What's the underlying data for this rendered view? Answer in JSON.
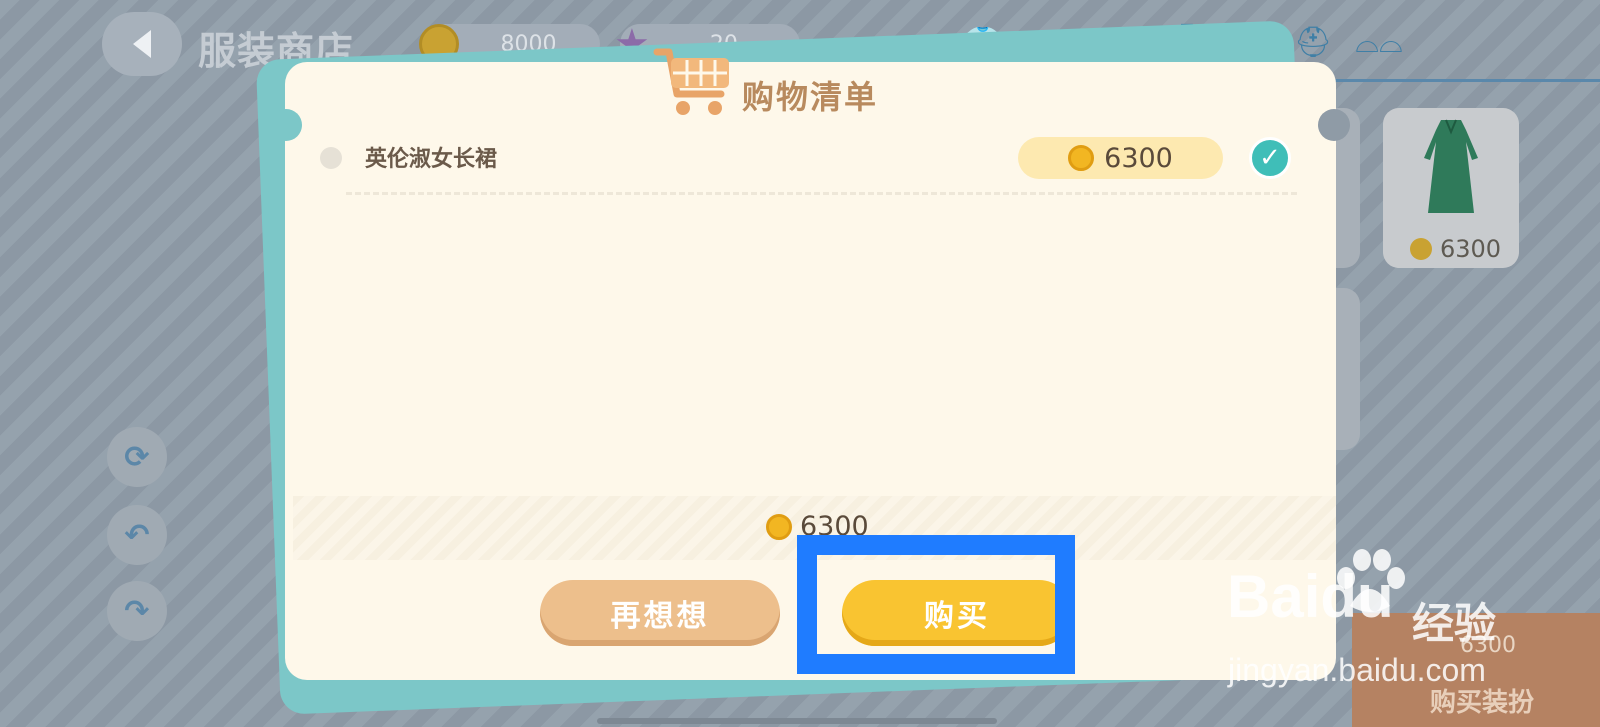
{
  "header": {
    "store_title": "服装商店",
    "coins": "8000",
    "stars": "20",
    "categories": [
      "shirt-icon",
      "pants-icon",
      "dress-icon",
      "shoe-icon",
      "sandal-icon",
      "hat-icon",
      "glasses-icon"
    ]
  },
  "shelf": {
    "item_price": "6300"
  },
  "cart": {
    "title": "购物清单",
    "items": [
      {
        "name": "英伦淑女长裙",
        "price": "6300",
        "checked": true
      }
    ],
    "total": "6300",
    "rethink_label": "再想想",
    "buy_label": "购买"
  },
  "buy_outfit": {
    "price": "6300",
    "label": "购买装扮"
  },
  "watermark": {
    "logo": "Baidu",
    "brand_cn": "经验",
    "url": "jingyan.baidu.com"
  },
  "colors": {
    "accent_highlight": "#1f7cff",
    "buy_button": "#f9c431",
    "rethink_button": "#edbf8c",
    "check": "#3fbeb8"
  }
}
